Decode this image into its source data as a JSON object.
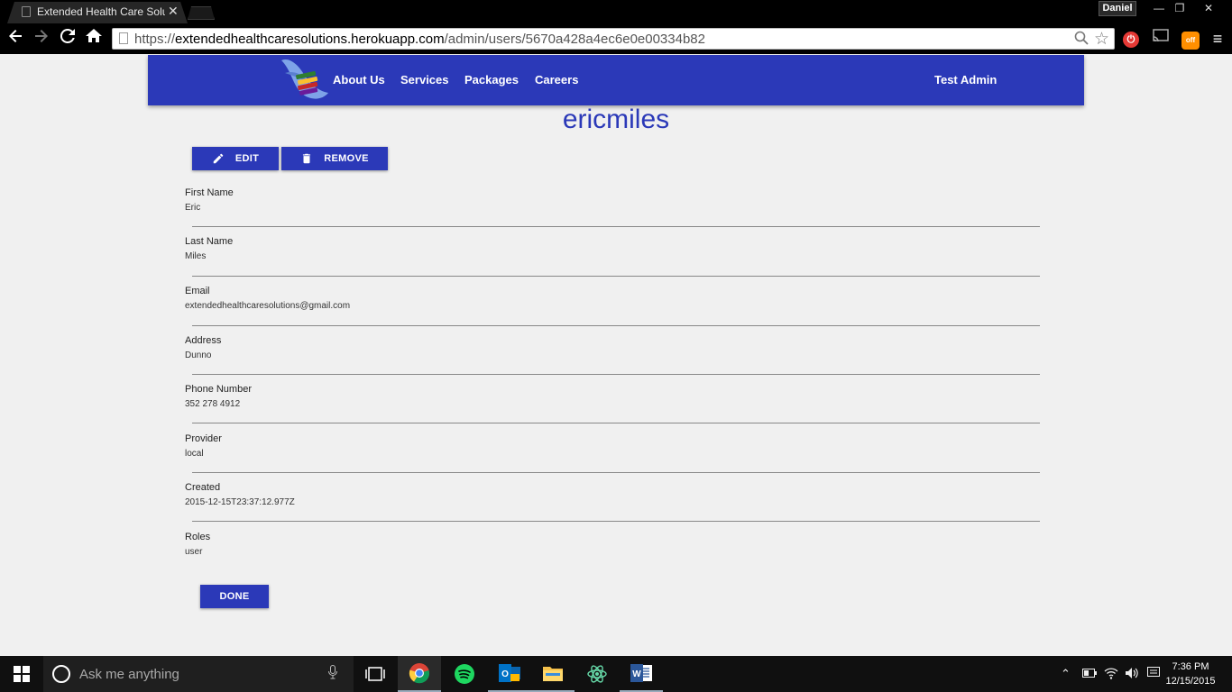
{
  "browser": {
    "tab_title": "Extended Health Care Solu",
    "profile_name": "Daniel",
    "url_scheme": "https://",
    "url_host": "extendedhealthcaresolutions.herokuapp.com",
    "url_path": "/admin/users/5670a428a4ec6e0e00334b82",
    "pet_badge": "off"
  },
  "header": {
    "nav": [
      "About Us",
      "Services",
      "Packages",
      "Careers"
    ],
    "user": "Test Admin"
  },
  "profile": {
    "username": "ericmiles",
    "edit_label": "EDIT",
    "remove_label": "REMOVE",
    "done_label": "DONE",
    "fields": [
      {
        "label": "First Name",
        "value": "Eric"
      },
      {
        "label": "Last Name",
        "value": "Miles"
      },
      {
        "label": "Email",
        "value": "extendedhealthcaresolutions@gmail.com"
      },
      {
        "label": "Address",
        "value": "Dunno"
      },
      {
        "label": "Phone Number",
        "value": "352 278 4912"
      },
      {
        "label": "Provider",
        "value": "local"
      },
      {
        "label": "Created",
        "value": "2015-12-15T23:37:12.977Z"
      },
      {
        "label": "Roles",
        "value": "user"
      }
    ]
  },
  "taskbar": {
    "search_placeholder": "Ask me anything",
    "time": "7:36 PM",
    "date": "12/15/2015"
  },
  "colors": {
    "brand": "#2b39b8",
    "page_bg": "#f0f0f0"
  }
}
